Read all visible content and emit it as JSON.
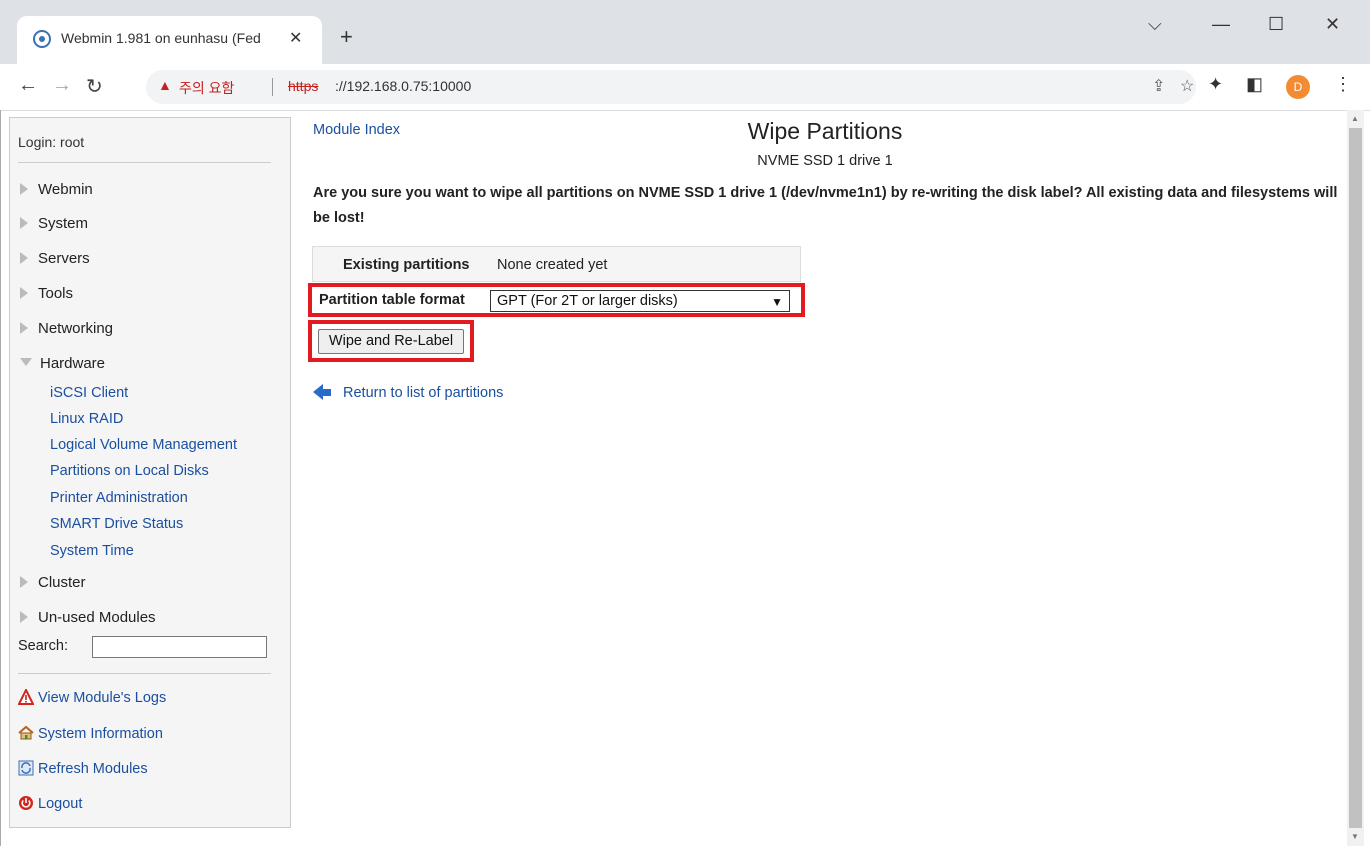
{
  "browser": {
    "tab_title": "Webmin 1.981 on eunhasu (Fed",
    "tab_close": "✕",
    "new_tab": "+",
    "security_warning": "주의 요함",
    "url_scheme": "https",
    "url_rest": "://192.168.0.75:10000",
    "avatar_letter": "D",
    "window_controls": {
      "dropdown": "⌵",
      "minimize": "—",
      "maximize": "☐",
      "close": "✕"
    }
  },
  "sidebar": {
    "login": "Login: root",
    "categories": [
      {
        "label": "Webmin"
      },
      {
        "label": "System"
      },
      {
        "label": "Servers"
      },
      {
        "label": "Tools"
      },
      {
        "label": "Networking"
      },
      {
        "label": "Hardware"
      }
    ],
    "hardware_items": [
      "iSCSI Client",
      "Linux RAID",
      "Logical Volume Management",
      "Partitions on Local Disks",
      "Printer Administration",
      "SMART Drive Status",
      "System Time"
    ],
    "more_categories": [
      {
        "label": "Cluster"
      },
      {
        "label": "Un-used Modules"
      }
    ],
    "search_label": "Search:",
    "bottom_links": [
      {
        "label": "View Module's Logs",
        "icon": "warning-icon"
      },
      {
        "label": "System Information",
        "icon": "house-icon"
      },
      {
        "label": "Refresh Modules",
        "icon": "refresh-icon"
      },
      {
        "label": "Logout",
        "icon": "power-icon"
      }
    ]
  },
  "main": {
    "module_index": "Module Index",
    "title": "Wipe Partitions",
    "subtitle": "NVME SSD 1 drive 1",
    "question": "Are you sure you want to wipe all partitions on NVME SSD 1 drive 1 (/dev/nvme1n1) by re-writing the disk label? All existing data and filesystems will be lost!",
    "existing_label": "Existing partitions",
    "existing_value": "None created yet",
    "format_label": "Partition table format",
    "format_value": "GPT (For 2T or larger disks)",
    "wipe_button": "Wipe and Re-Label",
    "return_link": "Return to list of partitions"
  },
  "colors": {
    "link": "#1a4f9f",
    "highlight": "#e21a22",
    "warning": "#c5221f"
  }
}
